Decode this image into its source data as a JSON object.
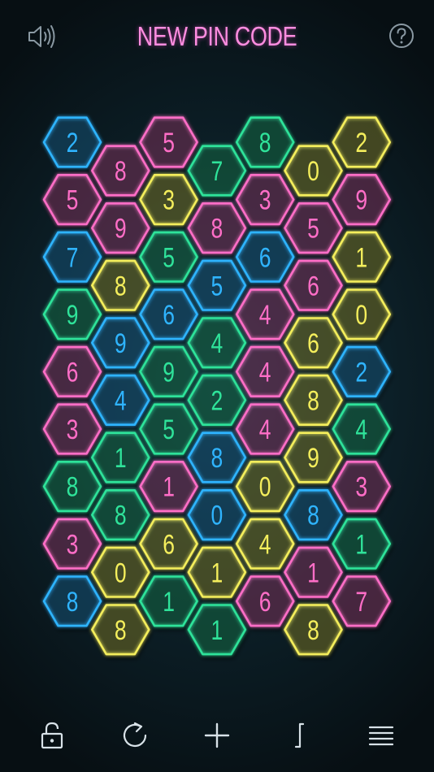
{
  "header": {
    "title": "NEW PIN CODE",
    "sound_icon": "speaker-icon",
    "help_icon": "question-mark-icon"
  },
  "colors": {
    "blue": "#2fb4ff",
    "pink": "#ff6ec7",
    "green": "#2fe39a",
    "yellow": "#f4ee5c",
    "title": "#ff8de0",
    "icon": "#8a99a3"
  },
  "board": {
    "columns": [
      [
        {
          "n": "2",
          "c": "blue"
        },
        {
          "n": "5",
          "c": "pink"
        },
        {
          "n": "7",
          "c": "blue"
        },
        {
          "n": "9",
          "c": "green"
        },
        {
          "n": "6",
          "c": "pink"
        },
        {
          "n": "3",
          "c": "pink"
        },
        {
          "n": "8",
          "c": "green"
        },
        {
          "n": "3",
          "c": "pink"
        },
        {
          "n": "8",
          "c": "blue"
        }
      ],
      [
        {
          "n": "8",
          "c": "pink"
        },
        {
          "n": "9",
          "c": "pink"
        },
        {
          "n": "8",
          "c": "yellow"
        },
        {
          "n": "9",
          "c": "blue"
        },
        {
          "n": "4",
          "c": "blue"
        },
        {
          "n": "1",
          "c": "green"
        },
        {
          "n": "8",
          "c": "green"
        },
        {
          "n": "0",
          "c": "yellow"
        },
        {
          "n": "8",
          "c": "yellow"
        }
      ],
      [
        {
          "n": "5",
          "c": "pink"
        },
        {
          "n": "3",
          "c": "yellow"
        },
        {
          "n": "5",
          "c": "green"
        },
        {
          "n": "6",
          "c": "blue"
        },
        {
          "n": "9",
          "c": "green"
        },
        {
          "n": "5",
          "c": "green"
        },
        {
          "n": "1",
          "c": "pink"
        },
        {
          "n": "6",
          "c": "yellow"
        },
        {
          "n": "1",
          "c": "green"
        }
      ],
      [
        {
          "n": "7",
          "c": "green"
        },
        {
          "n": "8",
          "c": "pink"
        },
        {
          "n": "5",
          "c": "blue"
        },
        {
          "n": "4",
          "c": "green"
        },
        {
          "n": "2",
          "c": "green"
        },
        {
          "n": "8",
          "c": "blue"
        },
        {
          "n": "0",
          "c": "blue"
        },
        {
          "n": "1",
          "c": "yellow"
        },
        {
          "n": "1",
          "c": "green"
        }
      ],
      [
        {
          "n": "8",
          "c": "green"
        },
        {
          "n": "3",
          "c": "pink"
        },
        {
          "n": "6",
          "c": "blue"
        },
        {
          "n": "4",
          "c": "pink"
        },
        {
          "n": "4",
          "c": "pink"
        },
        {
          "n": "4",
          "c": "pink"
        },
        {
          "n": "0",
          "c": "yellow"
        },
        {
          "n": "4",
          "c": "yellow"
        },
        {
          "n": "6",
          "c": "pink"
        }
      ],
      [
        {
          "n": "0",
          "c": "yellow"
        },
        {
          "n": "5",
          "c": "pink"
        },
        {
          "n": "6",
          "c": "pink"
        },
        {
          "n": "6",
          "c": "yellow"
        },
        {
          "n": "8",
          "c": "yellow"
        },
        {
          "n": "9",
          "c": "yellow"
        },
        {
          "n": "8",
          "c": "blue"
        },
        {
          "n": "1",
          "c": "pink"
        },
        {
          "n": "8",
          "c": "yellow"
        }
      ],
      [
        {
          "n": "2",
          "c": "yellow"
        },
        {
          "n": "9",
          "c": "pink"
        },
        {
          "n": "1",
          "c": "yellow"
        },
        {
          "n": "0",
          "c": "yellow"
        },
        {
          "n": "2",
          "c": "blue"
        },
        {
          "n": "4",
          "c": "green"
        },
        {
          "n": "3",
          "c": "pink"
        },
        {
          "n": "1",
          "c": "green"
        },
        {
          "n": "7",
          "c": "pink"
        }
      ]
    ]
  },
  "toolbar": [
    {
      "name": "unlock-button",
      "icon": "unlock-icon"
    },
    {
      "name": "reset-button",
      "icon": "refresh-icon"
    },
    {
      "name": "add-button",
      "icon": "plus-icon"
    },
    {
      "name": "integral-button",
      "icon": "integral-icon"
    },
    {
      "name": "menu-button",
      "icon": "menu-icon"
    }
  ]
}
